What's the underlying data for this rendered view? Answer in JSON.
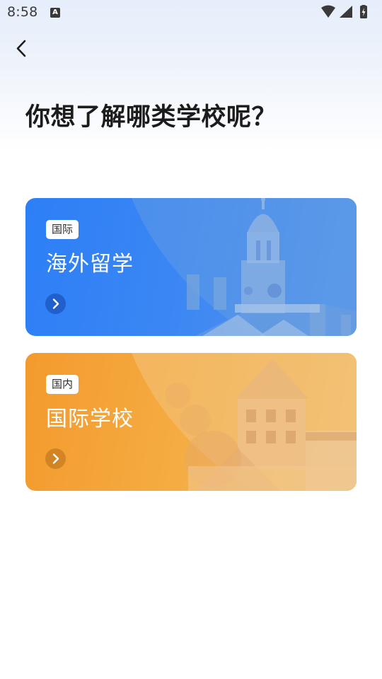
{
  "status_bar": {
    "time": "8:58",
    "notification_icon": "a-letter-icon",
    "icons": [
      "wifi-icon",
      "signal-icon",
      "battery-charging-icon"
    ]
  },
  "header": {
    "back_icon": "chevron-left-icon",
    "title": "你想了解哪类学校呢？"
  },
  "cards": [
    {
      "badge": "国际",
      "title": "海外留学",
      "accent": "#2d7ff6",
      "arrow_icon": "chevron-right-icon"
    },
    {
      "badge": "国内",
      "title": "国际学校",
      "accent": "#f39a2e",
      "arrow_icon": "chevron-right-icon"
    }
  ]
}
